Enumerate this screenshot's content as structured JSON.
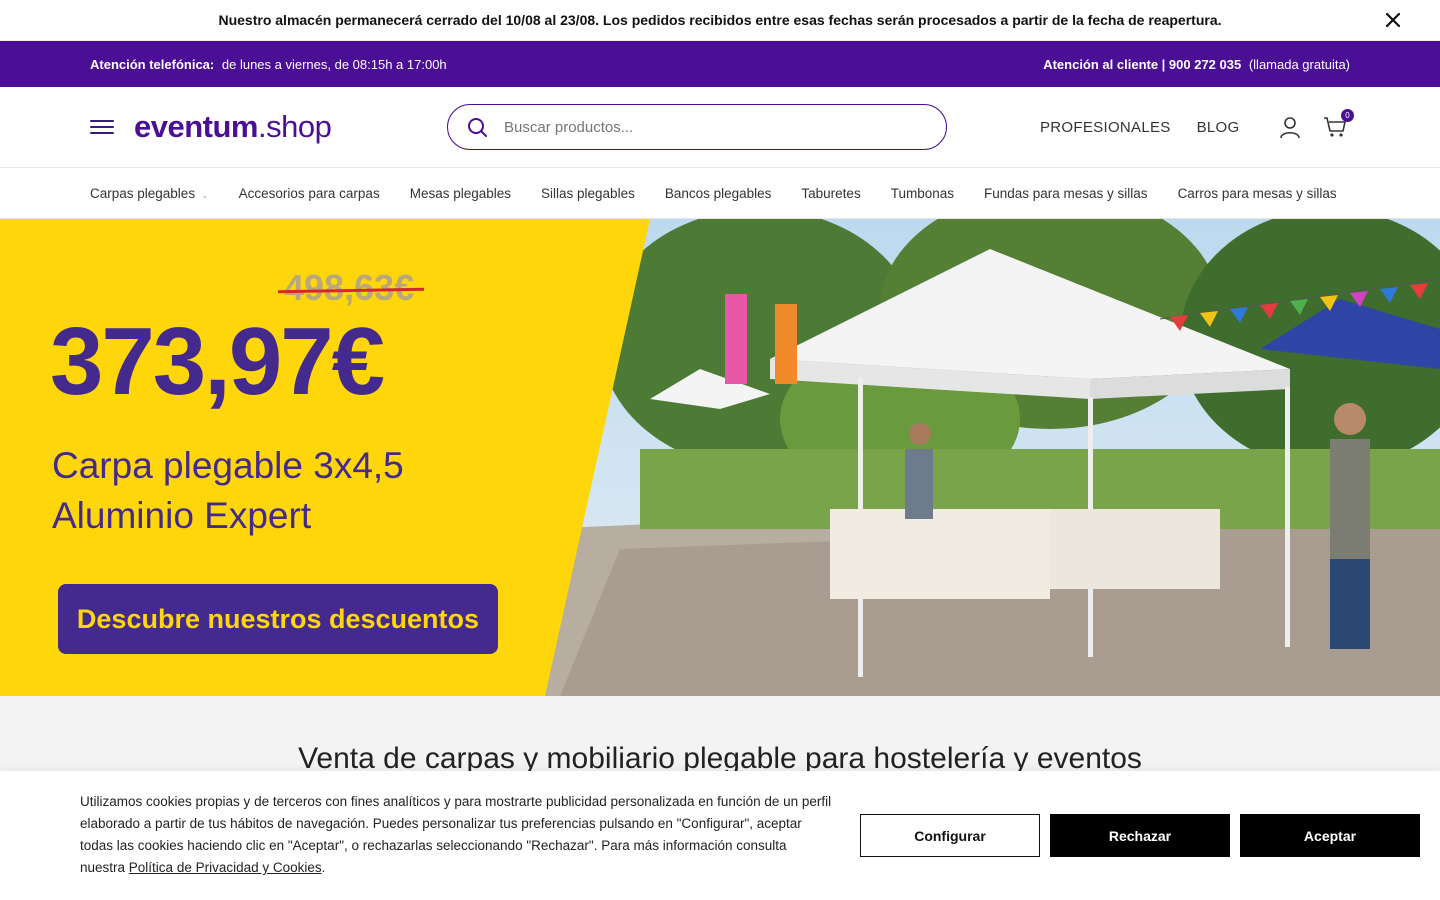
{
  "notice": {
    "text": "Nuestro almacén permanecerá cerrado del 10/08 al 23/08. Los pedidos recibidos entre esas fechas serán procesados a partir de la fecha de reapertura."
  },
  "contact": {
    "phone_label": "Atención telefónica:",
    "phone_hours": "de lunes a viernes, de 08:15h a 17:00h",
    "customer_label": "Atención al cliente | 900 272 035",
    "customer_note": "(llamada gratuita)"
  },
  "header": {
    "logo_bold": "eventum",
    "logo_light": ".shop",
    "search_placeholder": "Buscar productos...",
    "nav": [
      "PROFESIONALES",
      "BLOG"
    ],
    "cart_count": "0"
  },
  "categories": [
    "Carpas plegables",
    "Accesorios para carpas",
    "Mesas plegables",
    "Sillas plegables",
    "Bancos plegables",
    "Taburetes",
    "Tumbonas",
    "Fundas para mesas y sillas",
    "Carros para mesas y sillas"
  ],
  "hero": {
    "old_price": "498,63€",
    "new_price": "373,97€",
    "product_line1": "Carpa plegable 3x4,5",
    "product_line2": "Aluminio Expert",
    "cta": "Descubre nuestros descuentos",
    "accent": "#ffd60a",
    "brand": "#432a8c"
  },
  "intro": {
    "title": "Venta de carpas y mobiliario plegable para hostelería y eventos"
  },
  "cookie": {
    "text": "Utilizamos cookies propias y de terceros con fines analíticos y para mostrarte publicidad personalizada en función de un perfil elaborado a partir de tus hábitos de navegación. Puedes personalizar tus preferencias pulsando en \"Configurar\", aceptar todas las cookies haciendo clic en \"Aceptar\", o rechazarlas seleccionando \"Rechazar\". Para más información consulta nuestra",
    "link": "Política de Privacidad y Cookies",
    "end": ".",
    "configure": "Configurar",
    "reject": "Rechazar",
    "accept": "Aceptar"
  },
  "icons": [
    "close-icon",
    "menu-icon",
    "search-icon",
    "user-icon",
    "cart-icon",
    "chevron-down-icon"
  ],
  "colors": {
    "brand_purple": "#4b0f96",
    "yellow": "#ffd60a",
    "price_strike": "#d8262e"
  }
}
